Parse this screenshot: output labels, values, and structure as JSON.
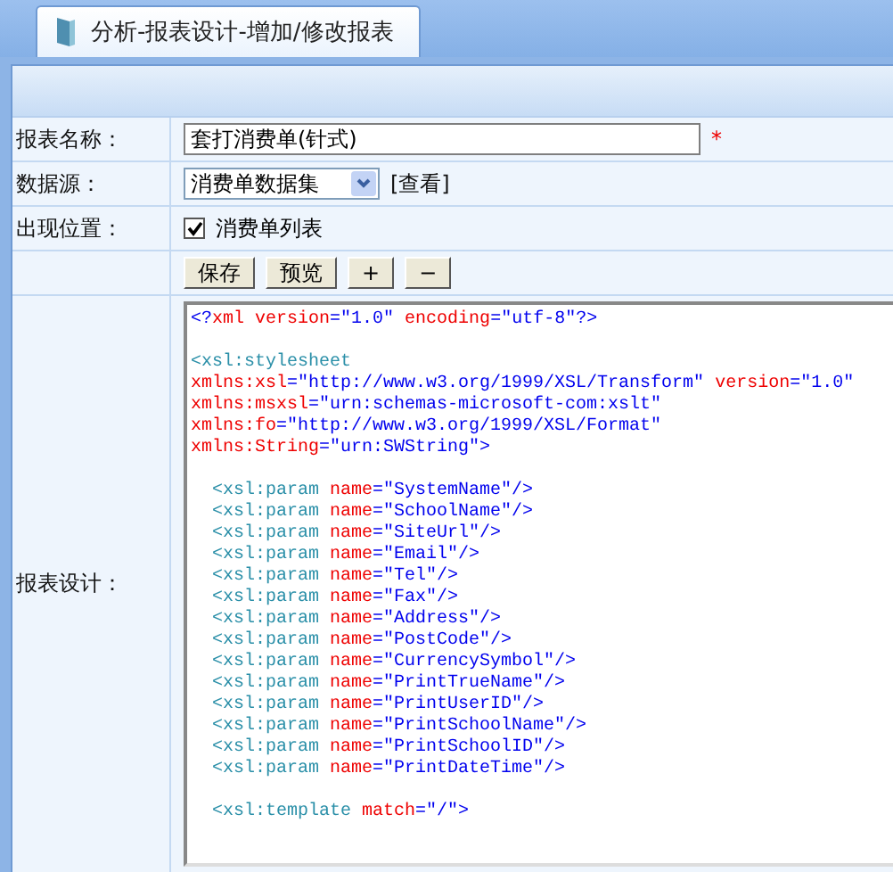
{
  "tab": {
    "title": "分析-报表设计-增加/修改报表"
  },
  "form": {
    "name_label": "报表名称：",
    "name_value": "套打消费单(针式)",
    "required_mark": "*",
    "source_label": "数据源：",
    "source_value": "消费单数据集",
    "view_link": "[查看]",
    "position_label": "出现位置：",
    "position_option": {
      "label": "消费单列表",
      "checked": true
    },
    "buttons": [
      "保存",
      "预览",
      "+",
      "−"
    ],
    "design_label": "报表设计："
  },
  "code_blocks": [
    [
      {
        "tokens": [
          {
            "kind": "punct",
            "text": "<?"
          },
          {
            "kind": "attr",
            "text": "xml version"
          },
          {
            "kind": "punct",
            "text": "=\"1.0\" "
          },
          {
            "kind": "attr",
            "text": "encoding"
          },
          {
            "kind": "punct",
            "text": "=\"utf-8\"?>"
          }
        ]
      }
    ],
    [
      {
        "tokens": [
          {
            "kind": "tag",
            "text": "<xsl:stylesheet"
          }
        ]
      },
      {
        "tokens": [
          {
            "kind": "attr",
            "text": "xmlns:xsl"
          },
          {
            "kind": "punct",
            "text": "=\"http://www.w3.org/1999/XSL/Transform\" "
          },
          {
            "kind": "attr",
            "text": "version"
          },
          {
            "kind": "punct",
            "text": "=\"1.0\""
          }
        ]
      },
      {
        "tokens": [
          {
            "kind": "attr",
            "text": "xmlns:msxsl"
          },
          {
            "kind": "punct",
            "text": "=\"urn:schemas-microsoft-com:xslt\""
          }
        ]
      },
      {
        "tokens": [
          {
            "kind": "attr",
            "text": "xmlns:fo"
          },
          {
            "kind": "punct",
            "text": "=\"http://www.w3.org/1999/XSL/Format\""
          }
        ]
      },
      {
        "tokens": [
          {
            "kind": "attr",
            "text": "xmlns:String"
          },
          {
            "kind": "punct",
            "text": "=\"urn:SWString\">"
          }
        ]
      }
    ],
    [
      {
        "tokens": [
          {
            "kind": "tag",
            "text": "  <xsl:param "
          },
          {
            "kind": "attr",
            "text": "name"
          },
          {
            "kind": "punct",
            "text": "=\"SystemName\"/>"
          }
        ]
      },
      {
        "tokens": [
          {
            "kind": "tag",
            "text": "  <xsl:param "
          },
          {
            "kind": "attr",
            "text": "name"
          },
          {
            "kind": "punct",
            "text": "=\"SchoolName\"/>"
          }
        ]
      },
      {
        "tokens": [
          {
            "kind": "tag",
            "text": "  <xsl:param "
          },
          {
            "kind": "attr",
            "text": "name"
          },
          {
            "kind": "punct",
            "text": "=\"SiteUrl\"/>"
          }
        ]
      },
      {
        "tokens": [
          {
            "kind": "tag",
            "text": "  <xsl:param "
          },
          {
            "kind": "attr",
            "text": "name"
          },
          {
            "kind": "punct",
            "text": "=\"Email\"/>"
          }
        ]
      },
      {
        "tokens": [
          {
            "kind": "tag",
            "text": "  <xsl:param "
          },
          {
            "kind": "attr",
            "text": "name"
          },
          {
            "kind": "punct",
            "text": "=\"Tel\"/>"
          }
        ]
      },
      {
        "tokens": [
          {
            "kind": "tag",
            "text": "  <xsl:param "
          },
          {
            "kind": "attr",
            "text": "name"
          },
          {
            "kind": "punct",
            "text": "=\"Fax\"/>"
          }
        ]
      },
      {
        "tokens": [
          {
            "kind": "tag",
            "text": "  <xsl:param "
          },
          {
            "kind": "attr",
            "text": "name"
          },
          {
            "kind": "punct",
            "text": "=\"Address\"/>"
          }
        ]
      },
      {
        "tokens": [
          {
            "kind": "tag",
            "text": "  <xsl:param "
          },
          {
            "kind": "attr",
            "text": "name"
          },
          {
            "kind": "punct",
            "text": "=\"PostCode\"/>"
          }
        ]
      },
      {
        "tokens": [
          {
            "kind": "tag",
            "text": "  <xsl:param "
          },
          {
            "kind": "attr",
            "text": "name"
          },
          {
            "kind": "punct",
            "text": "=\"CurrencySymbol\"/>"
          }
        ]
      },
      {
        "tokens": [
          {
            "kind": "tag",
            "text": "  <xsl:param "
          },
          {
            "kind": "attr",
            "text": "name"
          },
          {
            "kind": "punct",
            "text": "=\"PrintTrueName\"/>"
          }
        ]
      },
      {
        "tokens": [
          {
            "kind": "tag",
            "text": "  <xsl:param "
          },
          {
            "kind": "attr",
            "text": "name"
          },
          {
            "kind": "punct",
            "text": "=\"PrintUserID\"/>"
          }
        ]
      },
      {
        "tokens": [
          {
            "kind": "tag",
            "text": "  <xsl:param "
          },
          {
            "kind": "attr",
            "text": "name"
          },
          {
            "kind": "punct",
            "text": "=\"PrintSchoolName\"/>"
          }
        ]
      },
      {
        "tokens": [
          {
            "kind": "tag",
            "text": "  <xsl:param "
          },
          {
            "kind": "attr",
            "text": "name"
          },
          {
            "kind": "punct",
            "text": "=\"PrintSchoolID\"/>"
          }
        ]
      },
      {
        "tokens": [
          {
            "kind": "tag",
            "text": "  <xsl:param "
          },
          {
            "kind": "attr",
            "text": "name"
          },
          {
            "kind": "punct",
            "text": "=\"PrintDateTime\"/>"
          }
        ]
      }
    ],
    [
      {
        "tokens": [
          {
            "kind": "tag",
            "text": "  <xsl:template "
          },
          {
            "kind": "attr",
            "text": "match"
          },
          {
            "kind": "punct",
            "text": "=\"/\">"
          }
        ]
      }
    ]
  ]
}
